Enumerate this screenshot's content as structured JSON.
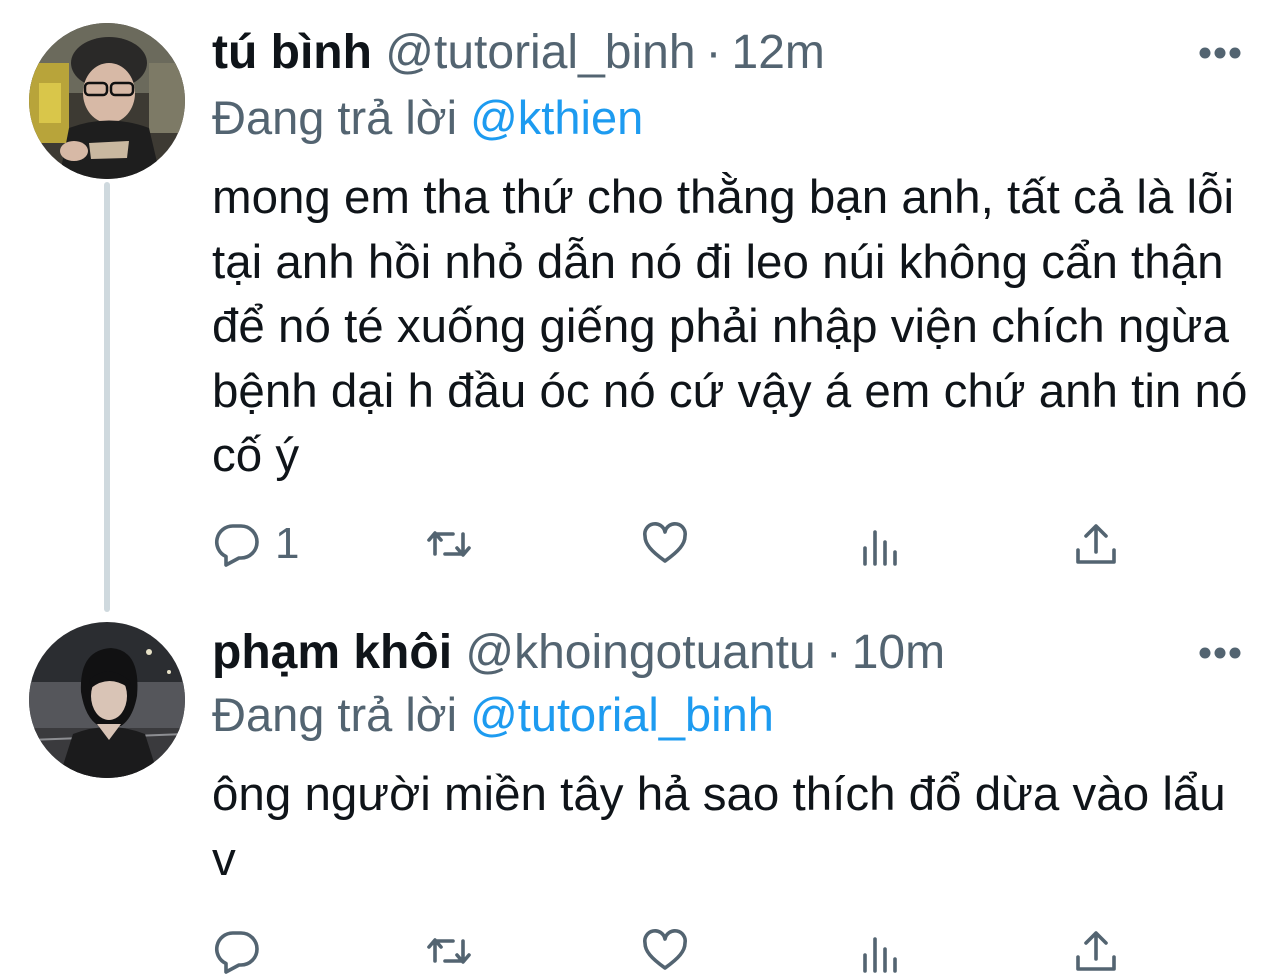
{
  "colors": {
    "text_primary": "#0f1419",
    "text_secondary": "#536471",
    "accent_link": "#1d9bf0",
    "thread_line": "#cfd9de"
  },
  "tweets": [
    {
      "display_name": "tú bình",
      "handle": "@tutorial_binh",
      "separator": "·",
      "time": "12m",
      "reply_prefix": "Đang trả lời",
      "reply_target": "@kthien",
      "text": "mong em tha thứ cho thằng bạn anh, tất cả là lỗi tại anh hồi nhỏ dẫn nó đi leo núi không cẩn thận để nó té xuống giếng phải nhập viện chích ngừa bệnh dại h đầu óc nó cứ vậy á em chứ anh tin nó cố ý",
      "reply_count": "1",
      "icons": [
        "reply-icon",
        "retweet-icon",
        "like-icon",
        "views-icon",
        "share-icon",
        "more-icon"
      ]
    },
    {
      "display_name": "phạm khôi",
      "handle": "@khoingotuantu",
      "separator": "·",
      "time": "10m",
      "reply_prefix": "Đang trả lời",
      "reply_target": "@tutorial_binh",
      "text": "ông người miền tây hả sao thích đổ dừa vào lẩu v",
      "reply_count": "",
      "icons": [
        "reply-icon",
        "retweet-icon",
        "like-icon",
        "views-icon",
        "share-icon",
        "more-icon"
      ]
    }
  ]
}
